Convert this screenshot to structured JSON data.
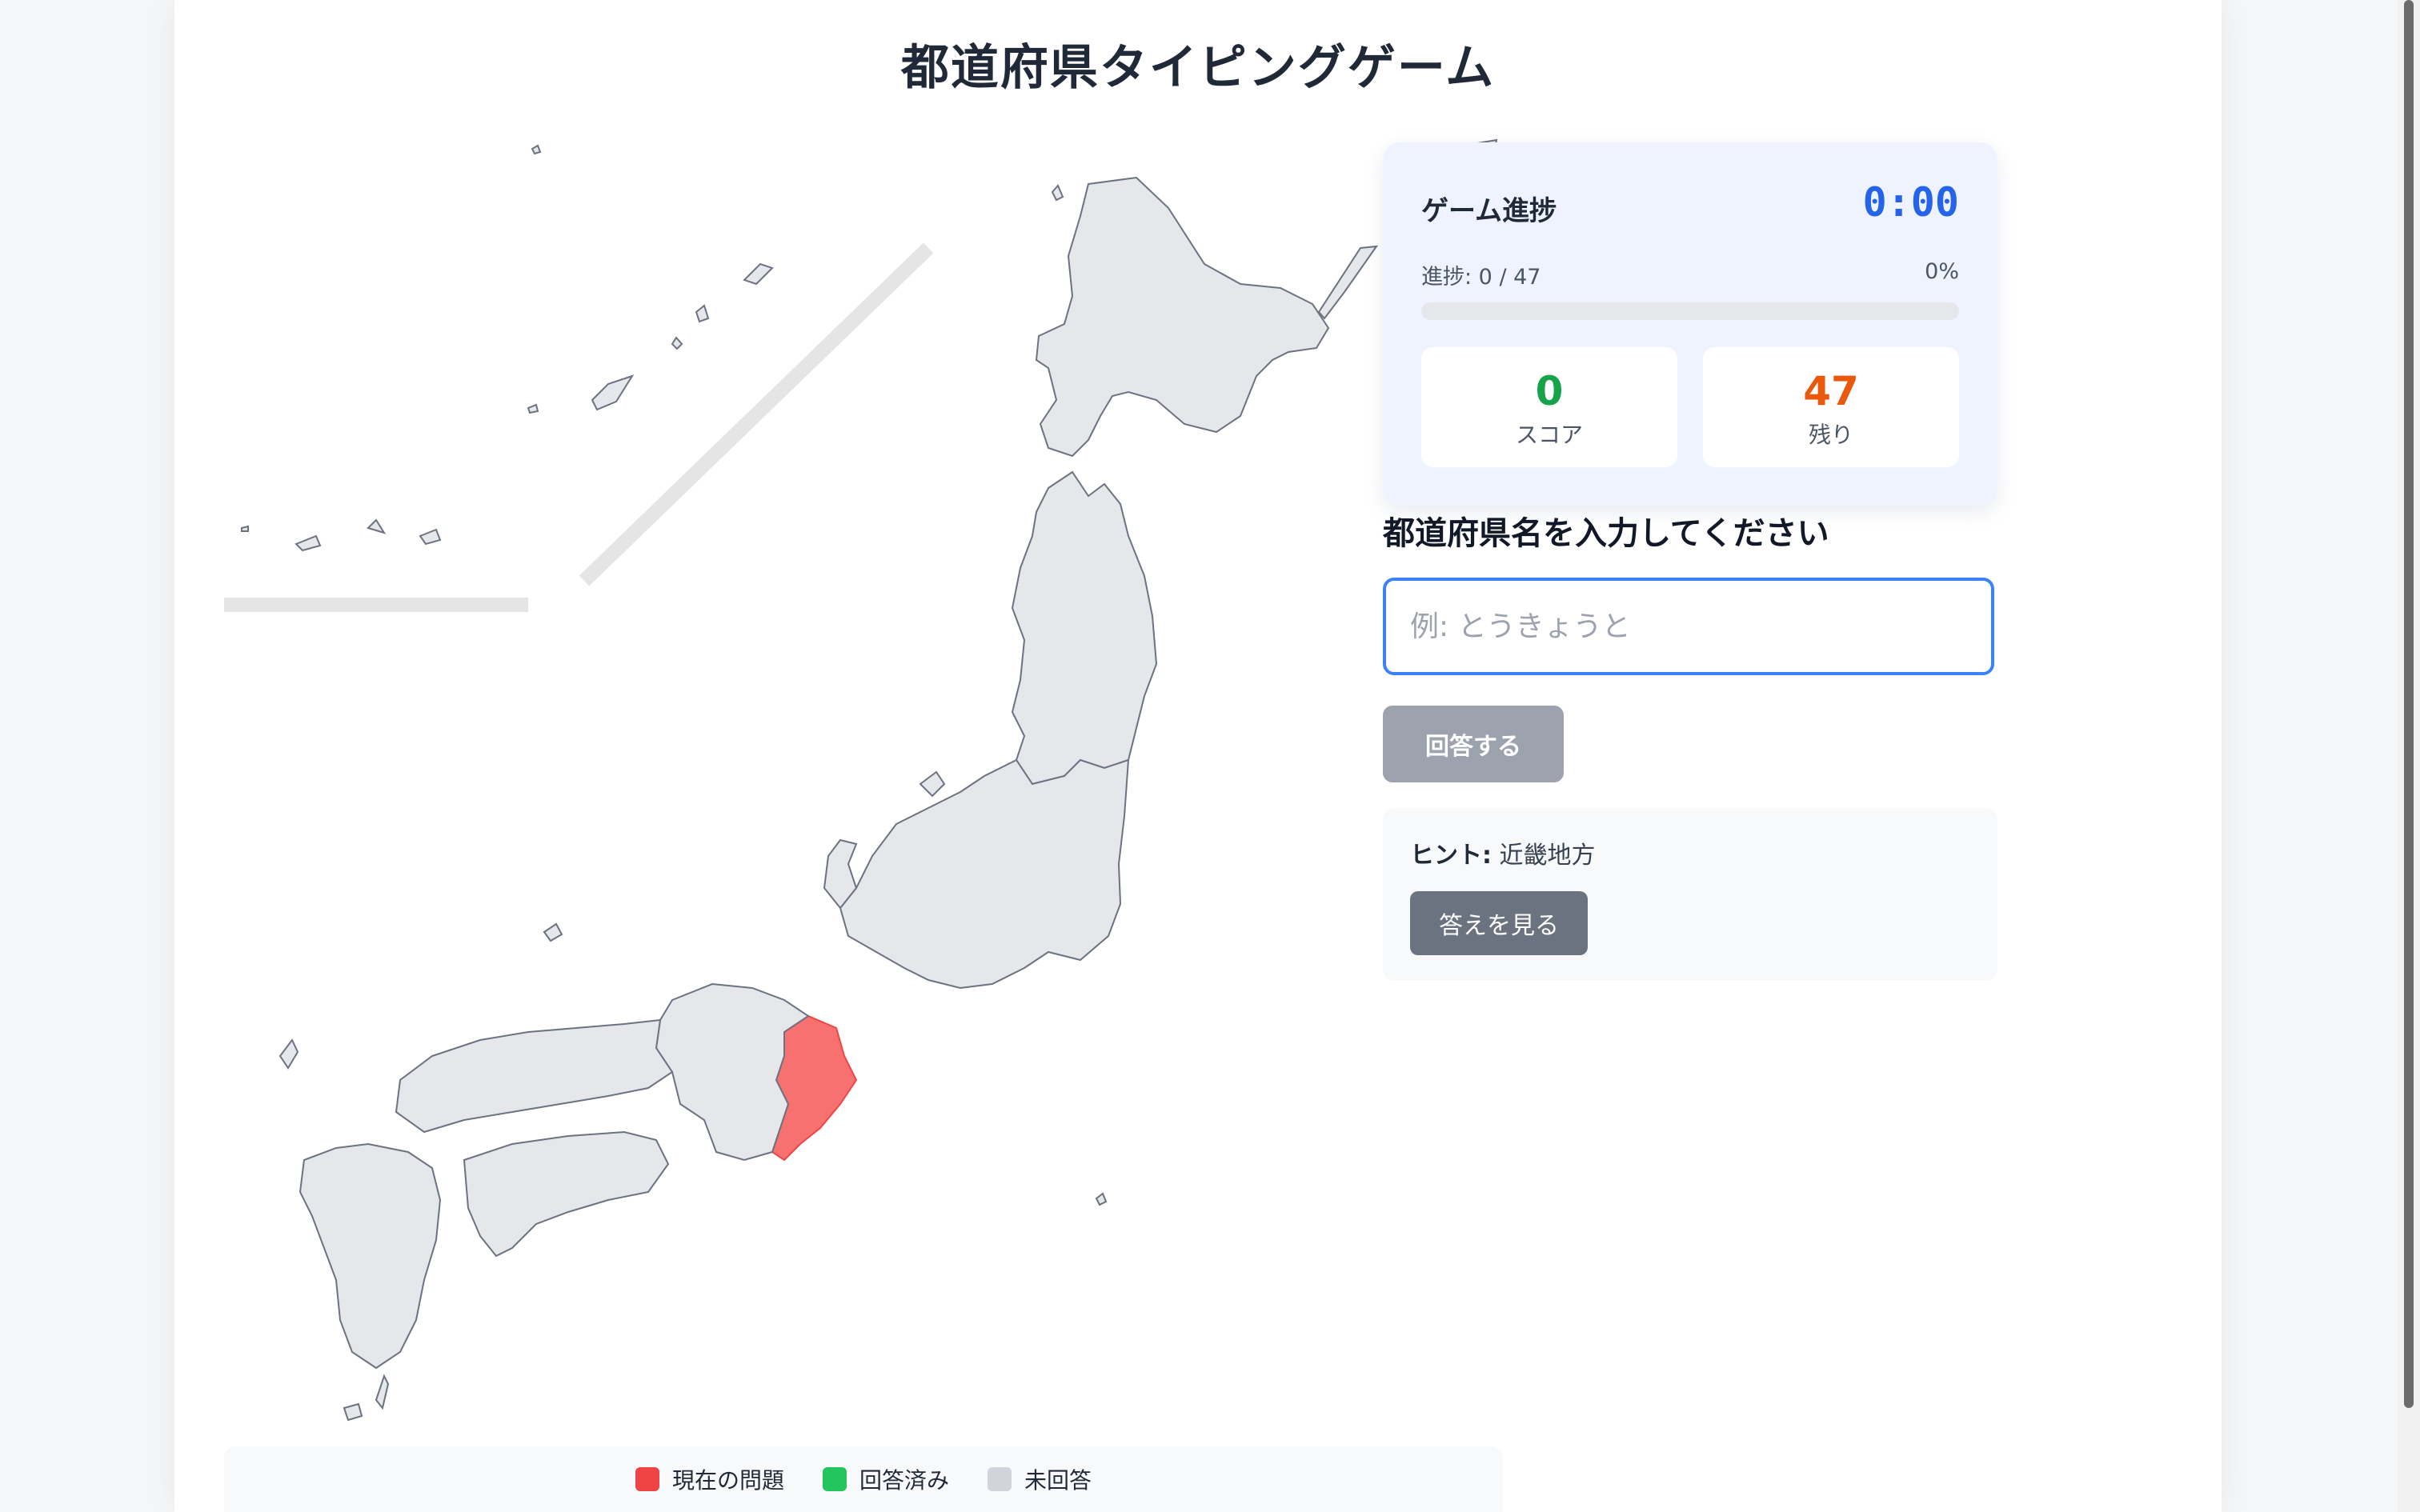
{
  "page": {
    "title": "都道府県タイピングゲーム"
  },
  "legend": [
    {
      "label": "現在の問題",
      "color": "#ef4444"
    },
    {
      "label": "回答済み",
      "color": "#22c55e"
    },
    {
      "label": "未回答",
      "color": "#d1d5db"
    }
  ],
  "progress": {
    "title": "ゲーム進捗",
    "timer": "0:00",
    "progress_text": "進捗: 0 / 47",
    "percent_text": "0%",
    "fraction": 0,
    "score_value": "0",
    "score_label": "スコア",
    "remaining_value": "47",
    "remaining_label": "残り",
    "score_color": "#16a34a",
    "remaining_color": "#ea580c"
  },
  "input": {
    "prompt": "都道府県名を入力してください",
    "placeholder": "例: とうきょうと",
    "value": ""
  },
  "buttons": {
    "submit_label": "回答する",
    "reveal_label": "答えを見る"
  },
  "hint": {
    "label": "ヒント:",
    "text": "近畿地方"
  },
  "map": {
    "current_color": "#f87171",
    "unanswered_color": "#e5e7eb",
    "border_color": "#6b7280"
  }
}
